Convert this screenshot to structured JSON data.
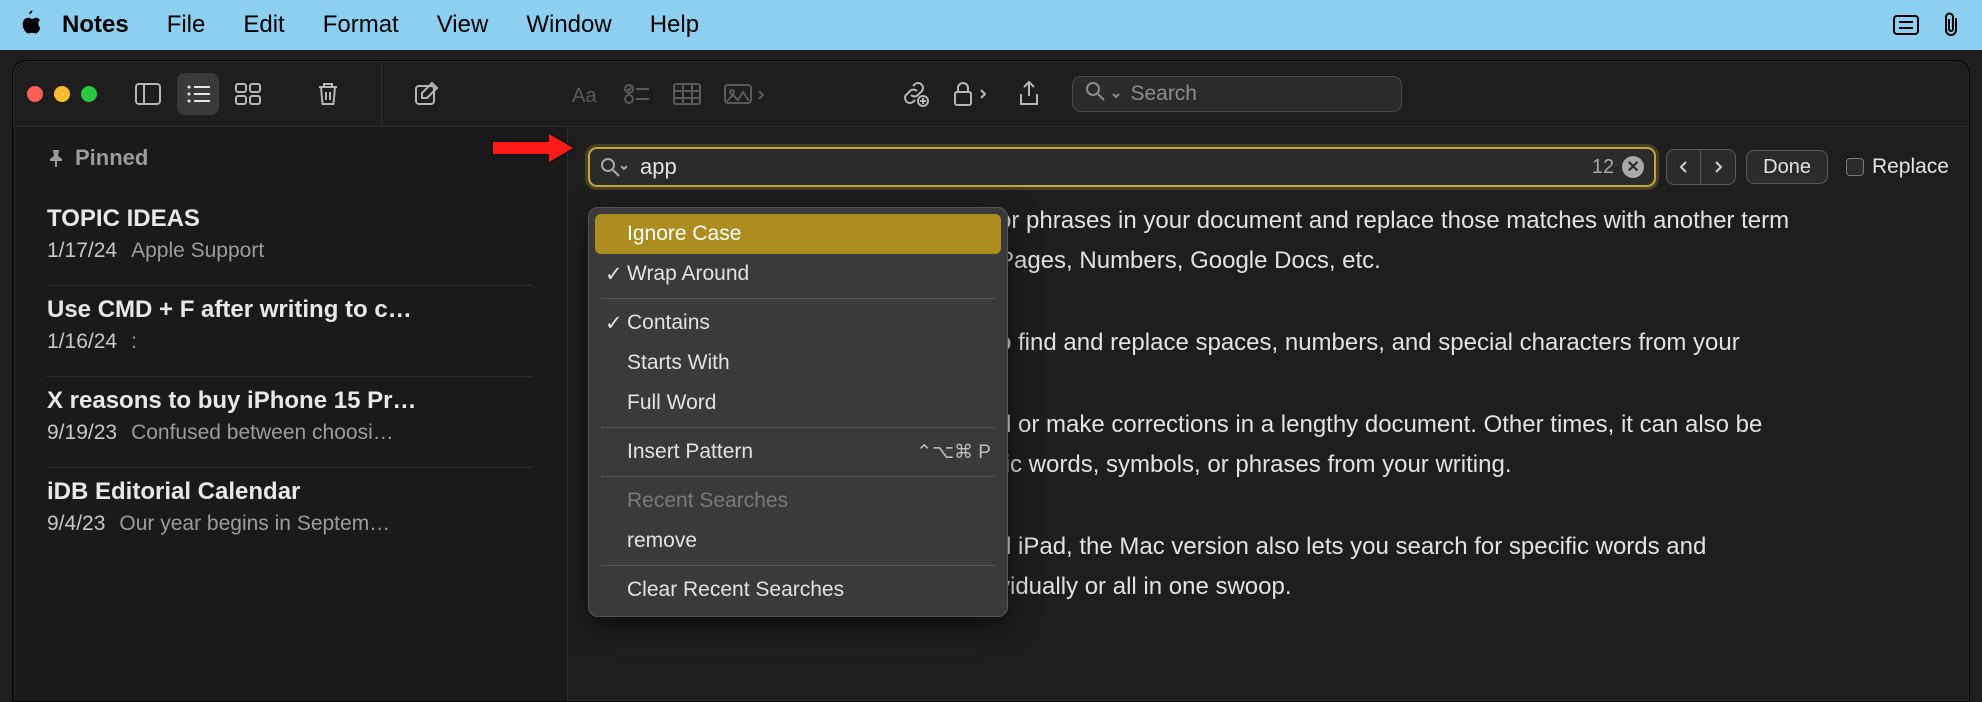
{
  "menubar": {
    "app": "Notes",
    "items": [
      "File",
      "Edit",
      "Format",
      "View",
      "Window",
      "Help"
    ]
  },
  "toolbar": {
    "search_placeholder": "Search"
  },
  "sidebar": {
    "pinned_label": "Pinned",
    "notes": [
      {
        "title": "TOPIC IDEAS",
        "date": "1/17/24",
        "preview": "Apple Support"
      },
      {
        "title": "Use CMD + F after writing to c…",
        "date": "1/16/24",
        "preview": ":"
      },
      {
        "title": "X reasons to buy iPhone 15 Pr…",
        "date": "9/19/23",
        "preview": "Confused between choosi…"
      },
      {
        "title": "iDB Editorial Calendar",
        "date": "9/4/23",
        "preview": "Our year begins in Septem…"
      }
    ]
  },
  "find": {
    "value": "app",
    "count": "12",
    "done": "Done",
    "replace_label": "Replace"
  },
  "dropdown": {
    "ignore_case": "Ignore Case",
    "wrap_around": "Wrap Around",
    "contains": "Contains",
    "starts_with": "Starts With",
    "full_word": "Full Word",
    "insert_pattern": "Insert Pattern",
    "insert_pattern_shortcut": "⌃⌥⌘ P",
    "recent_searches_header": "Recent Searches",
    "recent_item": "remove",
    "clear_recent": "Clear Recent Searches"
  },
  "body": {
    "p1": "or phrases in your document and replace those matches with another term",
    "p2": "Pages, Numbers, Google Docs, etc.",
    "p3": "o find and replace spaces, numbers, and special characters from your",
    "p4": "d or make corrections in a lengthy document. Other times, it can also be",
    "p5": "fic words, symbols, or phrases from your writing.",
    "p6": "d iPad, the Mac version also lets you search for specific words and",
    "p7": "vidually or all in one swoop."
  }
}
